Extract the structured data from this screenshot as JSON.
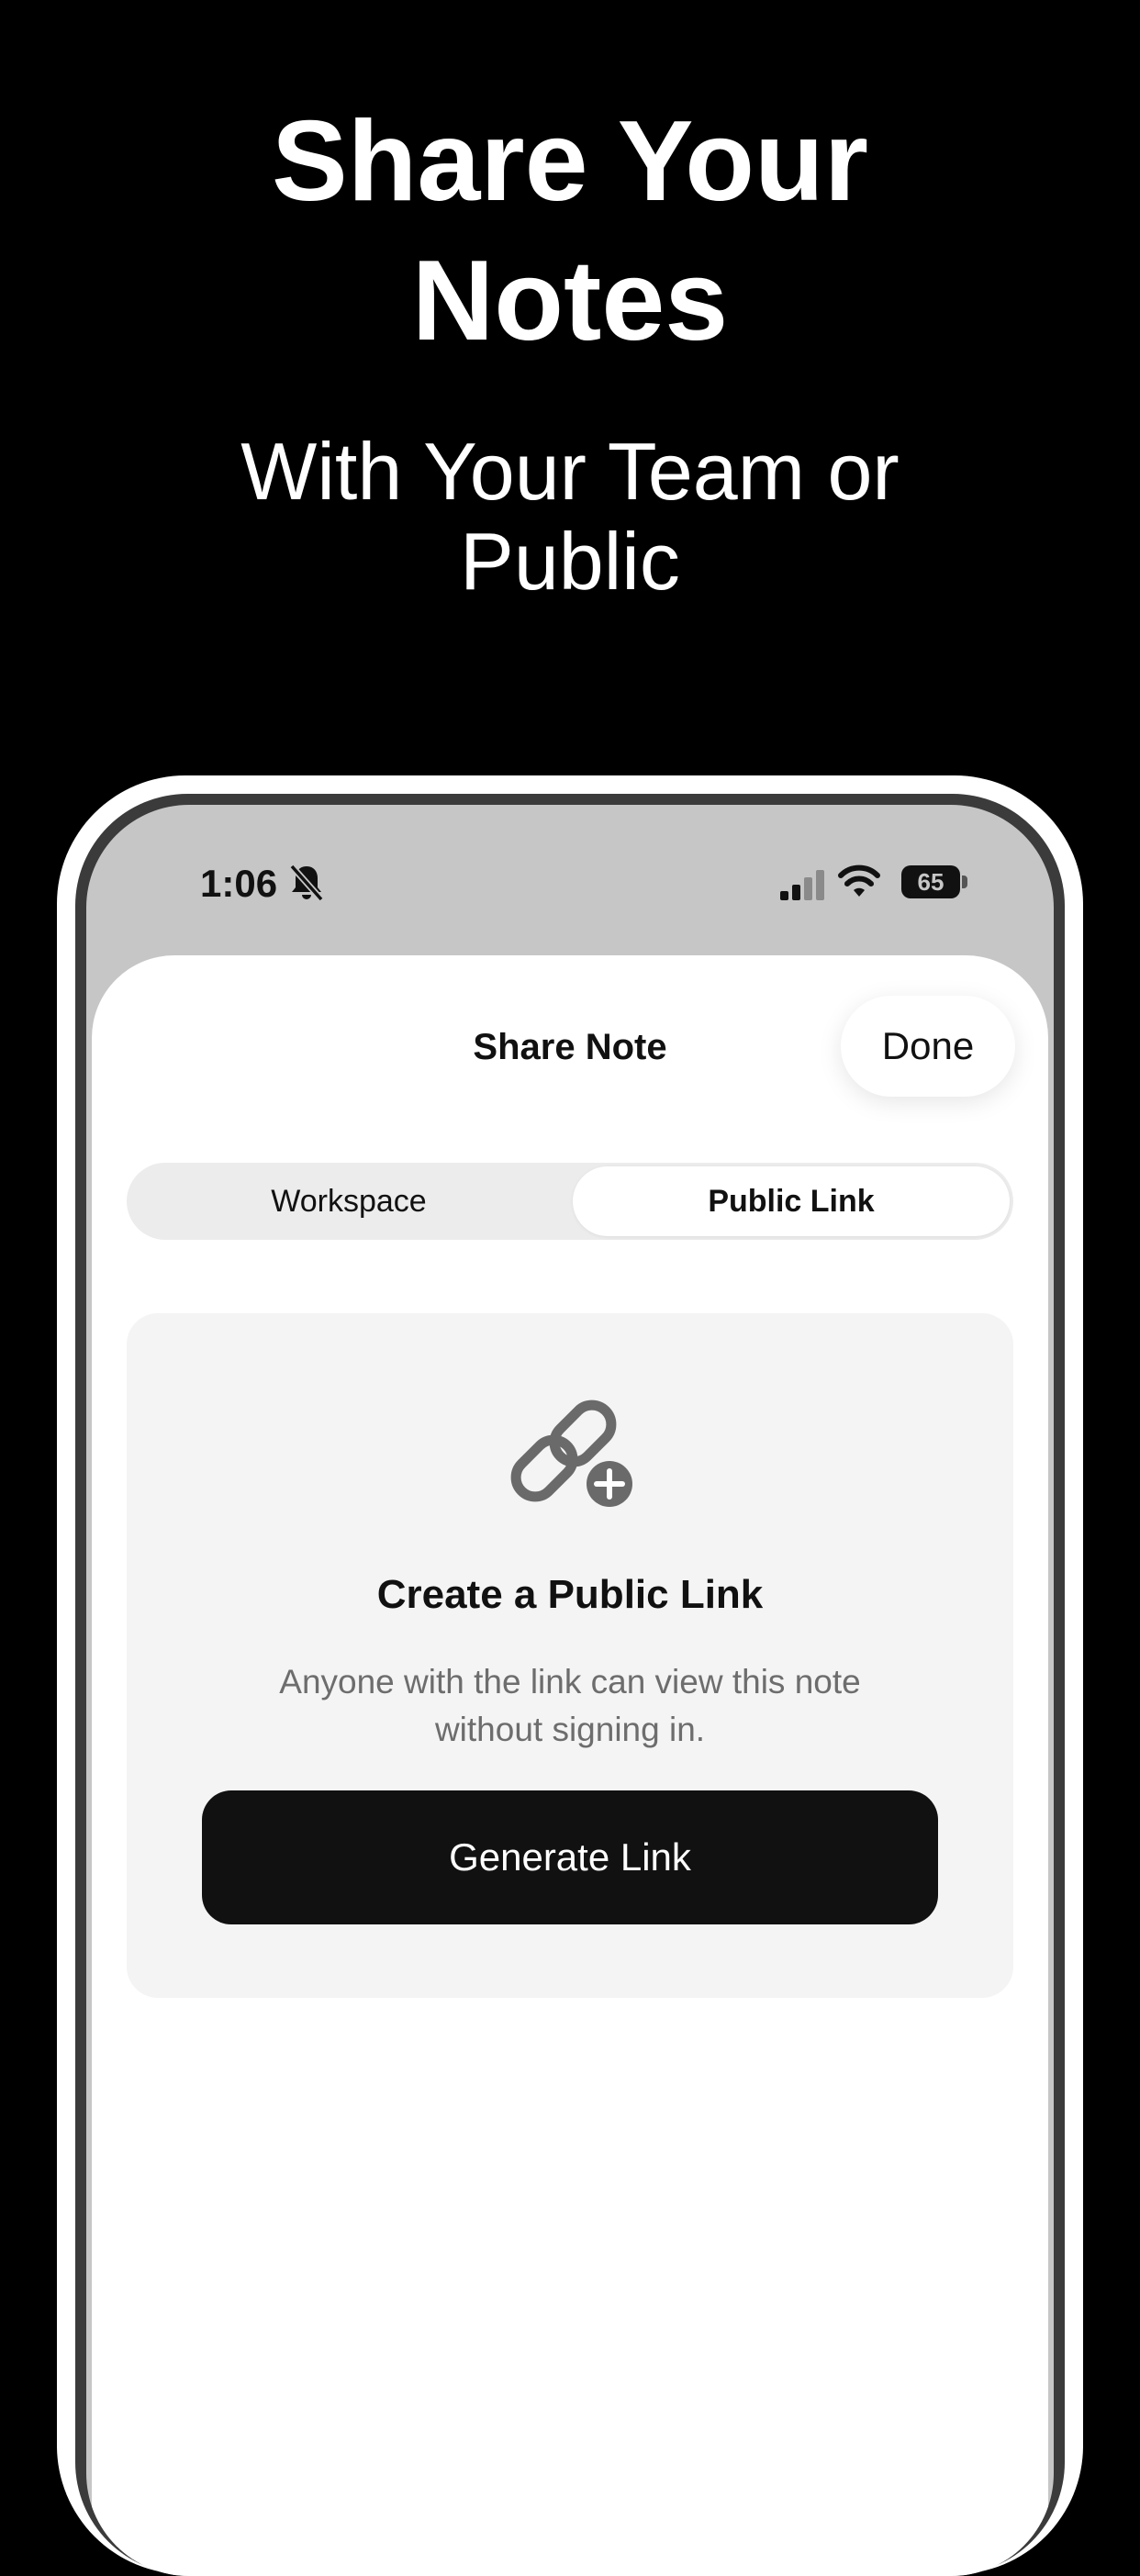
{
  "promo": {
    "title": "Share Your Notes",
    "subtitle": "With Your Team or Public"
  },
  "status_bar": {
    "time": "1:06",
    "battery": "65",
    "icons": [
      "bell-off-icon",
      "cellular-signal-icon",
      "wifi-icon",
      "battery-icon"
    ]
  },
  "sheet": {
    "title": "Share Note",
    "done_label": "Done"
  },
  "segmented_control": {
    "options": [
      {
        "label": "Workspace",
        "selected": false
      },
      {
        "label": "Public Link",
        "selected": true
      }
    ]
  },
  "public_link_card": {
    "icon": "link-add-icon",
    "heading": "Create a Public Link",
    "description": "Anyone with the link can view this note without signing in.",
    "button_label": "Generate Link"
  },
  "colors": {
    "background": "#000000",
    "sheet": "#ffffff",
    "card": "#f4f4f4",
    "primary_button": "#111111",
    "secondary_text": "#6d6d6d"
  }
}
